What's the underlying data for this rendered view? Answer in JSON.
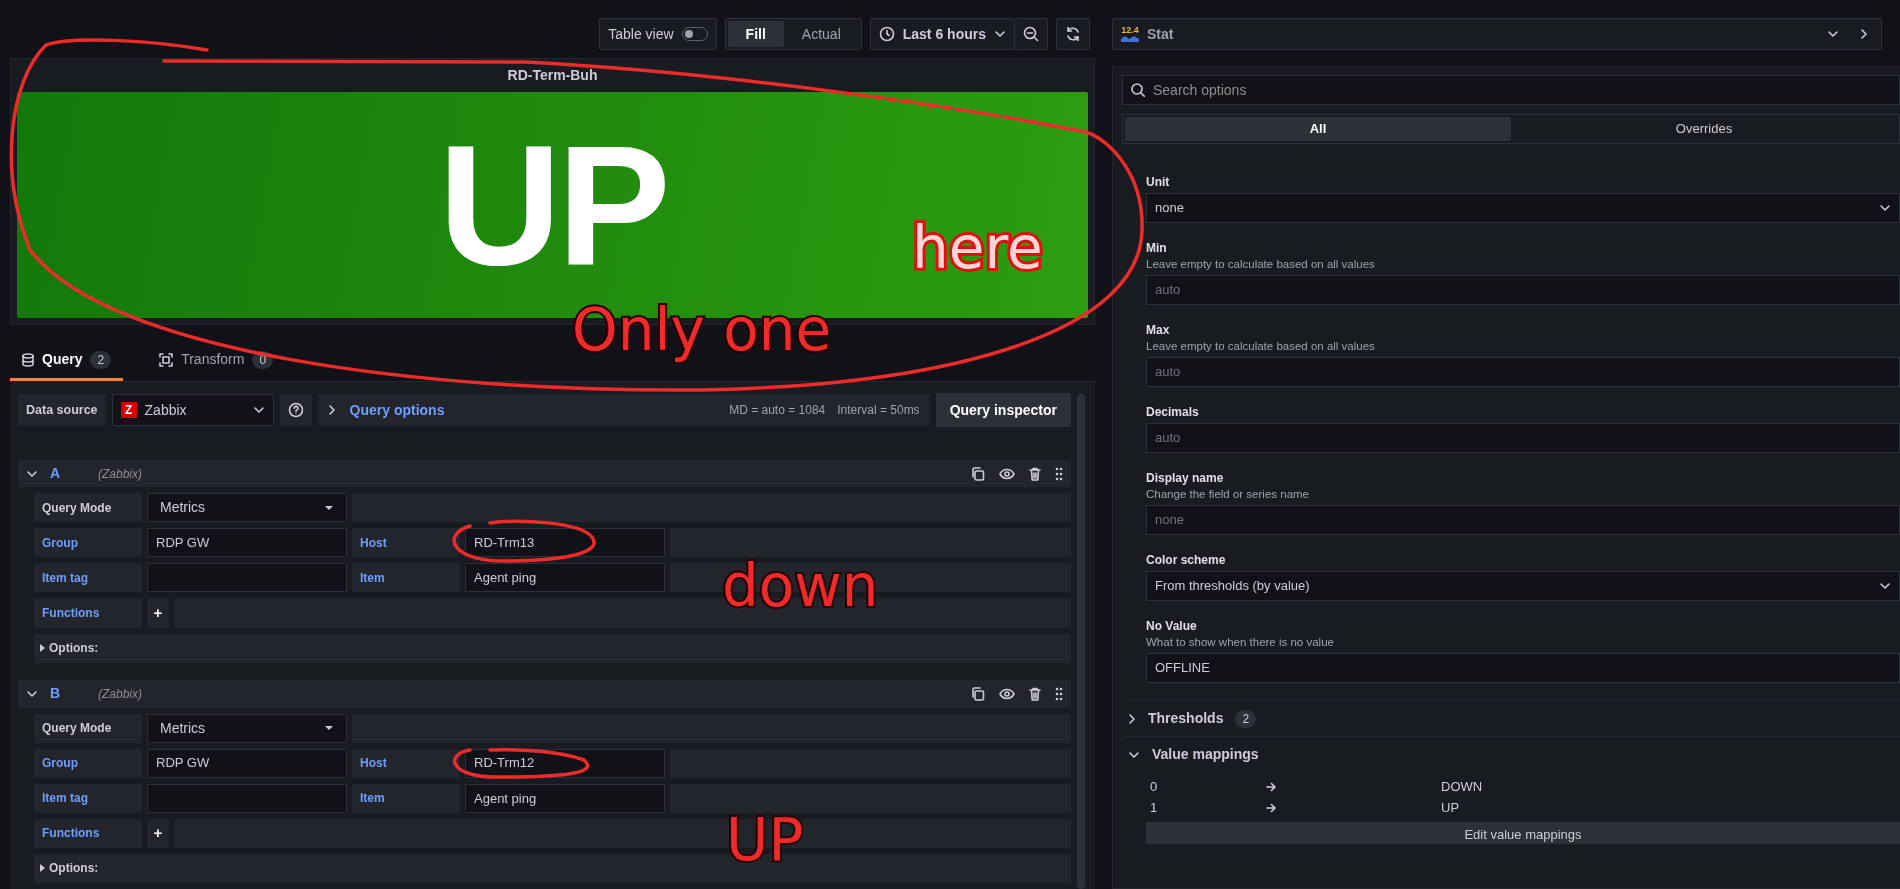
{
  "toolbar": {
    "table_view": {
      "label": "Table view",
      "on": false
    },
    "fill_modes": [
      {
        "label": "Fill",
        "selected": true
      },
      {
        "label": "Actual",
        "selected": false
      }
    ],
    "time_range": "Last 6 hours"
  },
  "panel": {
    "title": "RD-Term-Buh",
    "value": "UP"
  },
  "query_tabs": [
    {
      "label": "Query",
      "count": "2",
      "selected": true
    },
    {
      "label": "Transform",
      "count": "0",
      "selected": false
    }
  ],
  "data_source": {
    "label": "Data source",
    "logo_letter": "Z",
    "name": "Zabbix",
    "query_options": "Query options",
    "md": "MD = auto = 1084",
    "interval": "Interval = 50ms",
    "inspector": "Query inspector"
  },
  "queries": [
    {
      "ref": "A",
      "source": "(Zabbix)",
      "query_mode": {
        "label": "Query Mode",
        "value": "Metrics"
      },
      "fields": [
        [
          {
            "label": "Group",
            "value": "RDP GW"
          },
          {
            "label": "Host",
            "value": "RD-Trm13"
          }
        ],
        [
          {
            "label": "Item tag"
          },
          {
            "label": "Item",
            "value": "Agent ping"
          }
        ]
      ],
      "functions": "Functions",
      "add": "+",
      "options": "Options:"
    },
    {
      "ref": "B",
      "source": "(Zabbix)",
      "query_mode": {
        "label": "Query Mode",
        "value": "Metrics"
      },
      "fields": [
        [
          {
            "label": "Group",
            "value": "RDP GW"
          },
          {
            "label": "Host",
            "value": "RD-Trm12"
          }
        ],
        [
          {
            "label": "Item tag"
          },
          {
            "label": "Item",
            "value": "Agent ping"
          }
        ]
      ],
      "functions": "Functions",
      "add": "+",
      "options": "Options:"
    }
  ],
  "visualization": {
    "icon_text": "12.4",
    "name": "Stat"
  },
  "search": {
    "placeholder": "Search options"
  },
  "option_tabs": [
    {
      "label": "All",
      "selected": true
    },
    {
      "label": "Overrides",
      "selected": false
    }
  ],
  "options": [
    {
      "kind": "select",
      "label": "Unit",
      "value": "none"
    },
    {
      "kind": "input",
      "label": "Min",
      "description": "Leave empty to calculate based on all values",
      "placeholder": "auto"
    },
    {
      "kind": "input",
      "label": "Max",
      "description": "Leave empty to calculate based on all values",
      "placeholder": "auto"
    },
    {
      "kind": "input",
      "label": "Decimals",
      "placeholder": "auto"
    },
    {
      "kind": "input",
      "label": "Display name",
      "description": "Change the field or series name",
      "placeholder": "none"
    },
    {
      "kind": "select",
      "label": "Color scheme",
      "value": "From thresholds (by value)"
    },
    {
      "kind": "input",
      "label": "No Value",
      "description": "What to show when there is no value",
      "value": "OFFLINE"
    }
  ],
  "sections": [
    {
      "title": "Thresholds",
      "count": "2",
      "expanded": false
    },
    {
      "title": "Value mappings",
      "expanded": true,
      "mappings": [
        {
          "from": "0",
          "to": "DOWN"
        },
        {
          "from": "1",
          "to": "UP"
        }
      ],
      "button": "Edit value mappings"
    }
  ],
  "annotations": [
    {
      "text": "here"
    },
    {
      "text": "Only one"
    },
    {
      "text": "down"
    },
    {
      "text": "UP"
    }
  ]
}
